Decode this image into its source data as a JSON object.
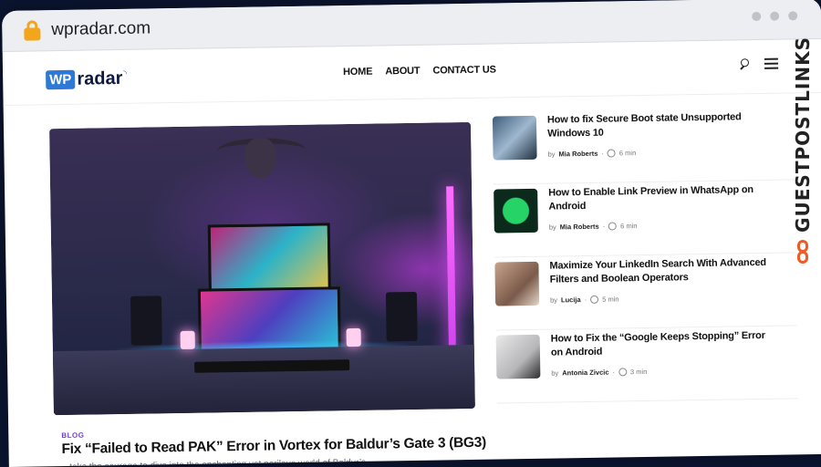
{
  "browser": {
    "url": "wpradar.com"
  },
  "site": {
    "logo_wp": "WP",
    "logo_radar": "radar",
    "nav": [
      "HOME",
      "ABOUT",
      "CONTACT US"
    ]
  },
  "featured": {
    "category": "BLOG",
    "title": "Fix “Failed to Read PAK” Error in Vortex for Baldur’s Gate 3 (BG3)",
    "excerpt": "...take the courage to dive into the enchanting yet perilous world of Baldur’s..."
  },
  "sidebar": {
    "items": [
      {
        "title": "How to fix Secure Boot state Unsupported Windows 10",
        "by": "by",
        "author": "Mia Roberts",
        "time": "6 min"
      },
      {
        "title": "How to Enable Link Preview in WhatsApp on Android",
        "by": "by",
        "author": "Mia Roberts",
        "time": "6 min"
      },
      {
        "title": "Maximize Your LinkedIn Search With Advanced Filters and Boolean Operators",
        "by": "by",
        "author": "Lucija",
        "time": "5 min"
      },
      {
        "title": "How to Fix the “Google Keeps Stopping” Error on Android",
        "by": "by",
        "author": "Antonia Zivcic",
        "time": "3 min"
      }
    ]
  },
  "badge": {
    "text": "GUESTPOSTLINKS"
  },
  "colors": {
    "accent": "#2e78d6",
    "category": "#6b3fd6",
    "badge_icon": "#f05a24"
  }
}
